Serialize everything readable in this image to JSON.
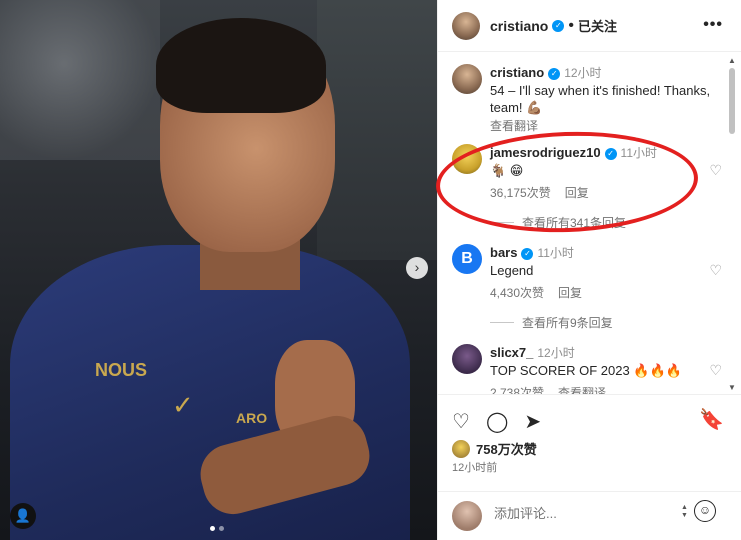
{
  "post_owner": {
    "username": "cristiano",
    "separator": "•",
    "follow_status": "已关注",
    "more": "•••"
  },
  "comments": [
    {
      "username": "cristiano",
      "time": "12小时",
      "text": "54 – I'll say when it's finished! Thanks, team! 💪🏽",
      "meta": [
        "查看翻译"
      ]
    },
    {
      "username": "jamesrodriguez10",
      "time": "11小时",
      "text": "🐐 😁",
      "meta": [
        "36,175次赞",
        "回复"
      ],
      "view_replies": "查看所有341条回复"
    },
    {
      "username": "bars",
      "time": "11小时",
      "text": "Legend",
      "meta": [
        "4,430次赞",
        "回复"
      ],
      "view_replies": "查看所有9条回复"
    },
    {
      "username": "slicx7_",
      "time": "12小时",
      "text": "TOP SCORER OF 2023 🔥🔥🔥",
      "meta": [
        "2,738次赞",
        "查看翻译"
      ]
    }
  ],
  "likes": "758万次赞",
  "posted": "12小时前",
  "add_comment": {
    "placeholder": "添加评论..."
  },
  "photo": {
    "sponsor_text": "ARO",
    "logo_text": "NOUS"
  },
  "colors": {
    "verified": "#0095f6",
    "highlight": "#e3201f"
  },
  "icons": [
    "heart-icon",
    "comment-icon",
    "share-icon",
    "bookmark-icon",
    "emoji-icon",
    "next-icon",
    "user-tag-icon"
  ]
}
